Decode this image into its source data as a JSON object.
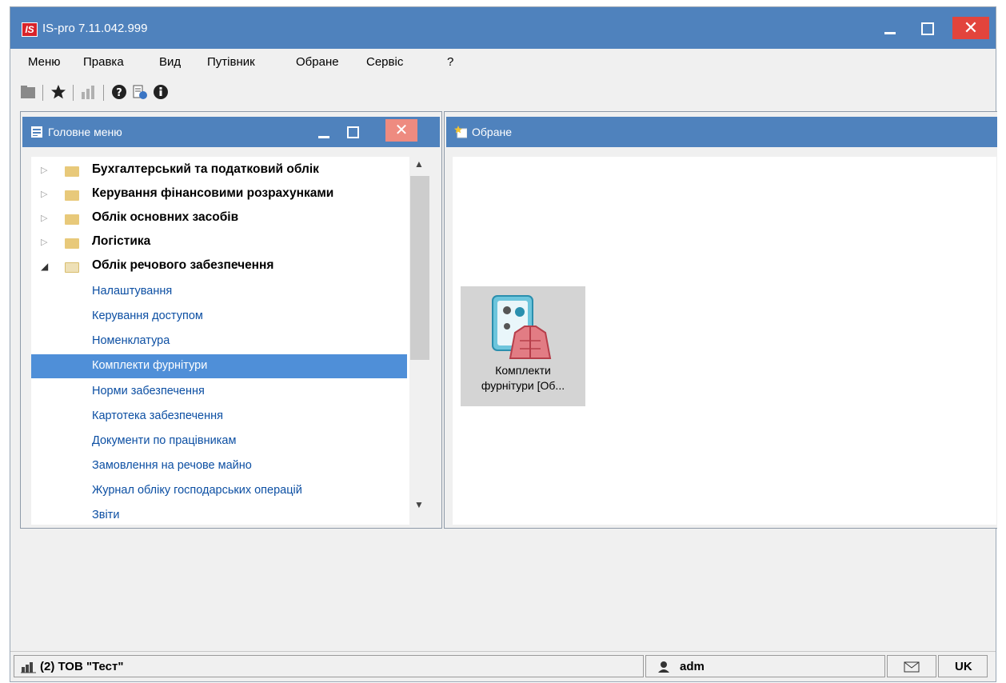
{
  "window": {
    "logo_text": "IS",
    "title": "IS-pro 7.11.042.999"
  },
  "menu": [
    {
      "label": "Меню"
    },
    {
      "label": "Правка"
    },
    {
      "label": "Вид"
    },
    {
      "label": "Путівник"
    },
    {
      "label": "Обране"
    },
    {
      "label": "Сервіс"
    },
    {
      "label": "?"
    }
  ],
  "toolbar": {
    "icons": [
      "folder-icon",
      "star-icon",
      "chart-icon",
      "help-icon",
      "document-help-icon",
      "info-icon"
    ]
  },
  "main_menu_panel": {
    "title": "Головне меню",
    "close_glyph": "✕",
    "tree": [
      {
        "label": "Бухгалтерський та податковий облік",
        "kind": "group",
        "expanded": false
      },
      {
        "label": "Керування фінансовими розрахунками",
        "kind": "group",
        "expanded": false
      },
      {
        "label": "Облік основних засобів",
        "kind": "group",
        "expanded": false
      },
      {
        "label": "Логістика",
        "kind": "group",
        "expanded": false
      },
      {
        "label": "Облік речового забезпечення",
        "kind": "group",
        "expanded": true
      },
      {
        "label": "Налаштування",
        "kind": "item"
      },
      {
        "label": "Керування доступом",
        "kind": "item"
      },
      {
        "label": "Номенклатура",
        "kind": "item"
      },
      {
        "label": "Комплекти фурнітури",
        "kind": "item",
        "selected": true
      },
      {
        "label": "Норми забезпечення",
        "kind": "item"
      },
      {
        "label": "Картотека забезпечення",
        "kind": "item"
      },
      {
        "label": "Документи по працівникам",
        "kind": "item"
      },
      {
        "label": "Замовлення на речове майно",
        "kind": "item"
      },
      {
        "label": "Журнал обліку господарських операцій",
        "kind": "item"
      },
      {
        "label": "Звіти",
        "kind": "item"
      }
    ]
  },
  "favorites_panel": {
    "title": "Обране",
    "tile": {
      "line1": "Комплекти",
      "line2": "фурнітури [Об..."
    }
  },
  "statusbar": {
    "organization": "(2) ТОВ \"Тест\"",
    "user": "adm",
    "language": "UK"
  },
  "colors": {
    "titlebar": "#4f82bd",
    "close_button": "#e2443c",
    "selection": "#4f8fd8",
    "link_text": "#0c4fa3"
  }
}
